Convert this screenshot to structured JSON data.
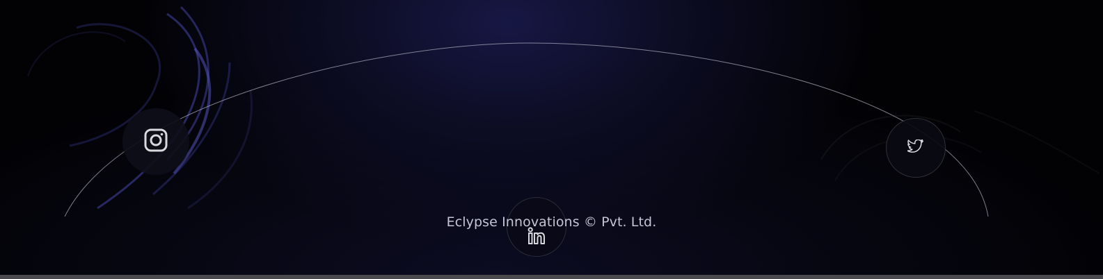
{
  "footer": {
    "copyright": "Eclypse Innovations © Pvt. Ltd.",
    "social_links": [
      {
        "network": "instagram",
        "icon": "instagram-icon"
      },
      {
        "network": "linkedin",
        "icon": "linkedin-icon"
      },
      {
        "network": "twitter",
        "icon": "twitter-icon"
      }
    ]
  },
  "colors": {
    "background": "#020205",
    "glow": "#18184a",
    "accent_swirl": "#3a3a9e",
    "text": "#c5c5d6",
    "icon": "#d8d8de",
    "arc": "#9a9aa6"
  }
}
